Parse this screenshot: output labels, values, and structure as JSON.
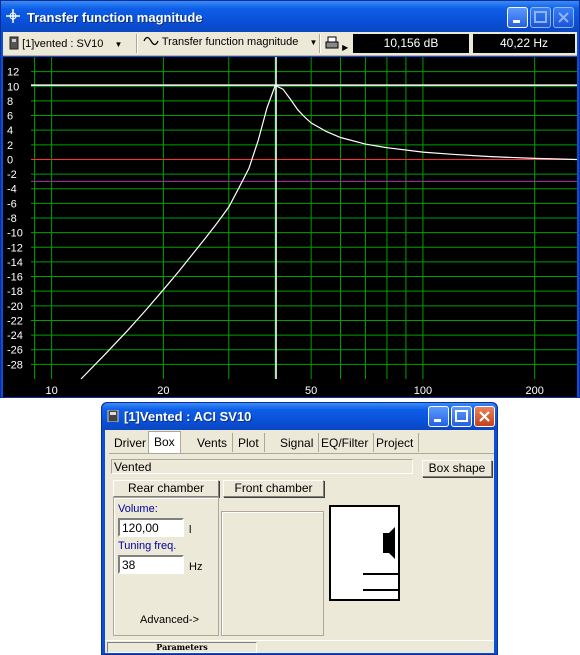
{
  "plot_window": {
    "title": "Transfer function magnitude",
    "toolbar": {
      "driver_selector": "[1]vented : SV10",
      "curve_selector": "Transfer function magnitude",
      "readout_db": "10,156 dB",
      "readout_hz": "40,22 Hz"
    }
  },
  "chart_data": {
    "type": "line",
    "title": "Transfer function magnitude",
    "x_scale": "log",
    "xlim": [
      8.8,
      260
    ],
    "ylim": [
      -30,
      14
    ],
    "x_ticks": [
      10,
      20,
      50,
      100,
      200
    ],
    "x_tick_labels": [
      "10",
      "20",
      "50",
      "100",
      "200"
    ],
    "y_ticks": [
      12,
      10,
      8,
      6,
      4,
      2,
      0,
      -2,
      -4,
      -6,
      -8,
      -10,
      -12,
      -14,
      -16,
      -18,
      -20,
      -22,
      -24,
      -26,
      -28
    ],
    "y_tick_labels": [
      "12",
      "10",
      "8",
      "6",
      "4",
      "2",
      "0",
      "-2",
      "-4",
      "-6",
      "-8",
      "-10",
      "-12",
      "-14",
      "-16",
      "-18",
      "-20",
      "-22",
      "-24",
      "-26",
      "-28"
    ],
    "grid": true,
    "colors": {
      "background": "#000000",
      "grid": "#00a000",
      "curve": "#ffffff",
      "zero_line": "#ff3030",
      "minus3_line": "#b030b0",
      "cursor": "#ffffff"
    },
    "series": [
      {
        "x": [
          12,
          14,
          16,
          18,
          20,
          22,
          24,
          26,
          28,
          30,
          32,
          34,
          36,
          38,
          40,
          42,
          44,
          46,
          48,
          50,
          55,
          60,
          70,
          80,
          100,
          120,
          150,
          200,
          260
        ],
        "y": [
          -30,
          -26.5,
          -23.4,
          -20.5,
          -17.8,
          -15.3,
          -12.9,
          -10.7,
          -8.6,
          -6.5,
          -3.8,
          -1.2,
          2.6,
          7,
          10.1,
          9.6,
          8.2,
          6.8,
          5.8,
          5,
          3.8,
          3,
          2.1,
          1.6,
          1,
          0.7,
          0.4,
          0.15,
          0
        ]
      }
    ],
    "reference_lines": [
      {
        "y": 0
      },
      {
        "y": -3
      }
    ],
    "cursor": {
      "x": 40.22,
      "y": 10.156
    }
  },
  "box_window": {
    "title": "[1]Vented : ACI SV10",
    "tabs": [
      "Driver",
      "Box",
      "Vents",
      "Plot",
      "Signal",
      "EQ/Filter",
      "Project"
    ],
    "active_tab": "Box",
    "box_type": "Vented",
    "box_shape_button": "Box shape",
    "rear_chamber_button": "Rear chamber",
    "front_chamber_button": "Front chamber",
    "volume_label": "Volume:",
    "volume_value": "120,00",
    "volume_unit": "l",
    "tuning_label": "Tuning freq.",
    "tuning_value": "38",
    "tuning_unit": "Hz",
    "advanced_button": "Advanced->",
    "status": "Parameters"
  }
}
